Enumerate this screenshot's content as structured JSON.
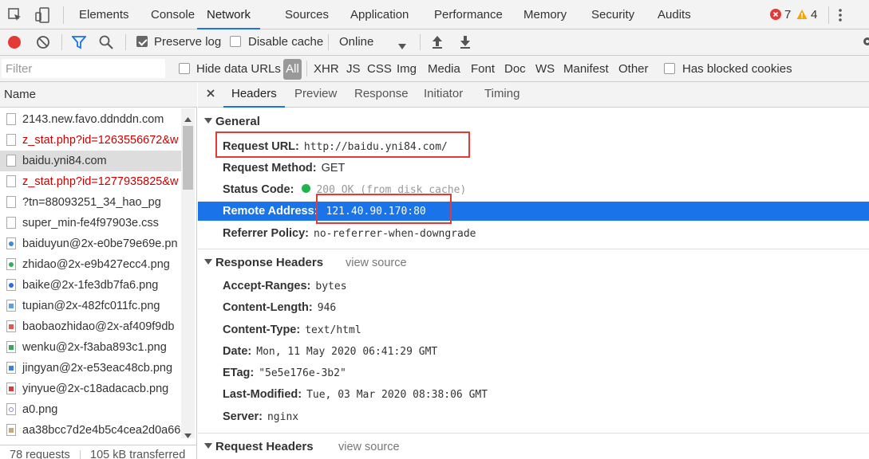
{
  "main_tabs": [
    "Elements",
    "Console",
    "Network",
    "Sources",
    "Application",
    "Performance",
    "Memory",
    "Security",
    "Audits"
  ],
  "active_main_tab": "Network",
  "counts": {
    "errors": "7",
    "warnings": "4"
  },
  "toolbar": {
    "preserve_log": "Preserve log",
    "disable_cache": "Disable cache",
    "throttle": "Online"
  },
  "filter": {
    "placeholder": "Filter",
    "hide_data_urls": "Hide data URLs",
    "all": "All",
    "types": [
      "XHR",
      "JS",
      "CSS",
      "Img",
      "Media",
      "Font",
      "Doc",
      "WS",
      "Manifest",
      "Other"
    ],
    "has_blocked_cookies": "Has blocked cookies"
  },
  "requests_panel": {
    "header": "Name",
    "rows": [
      {
        "name": "2143.new.favo.ddnddn.com"
      },
      {
        "name": "z_stat.php?id=1263556672&w"
      },
      {
        "name": "baidu.yni84.com"
      },
      {
        "name": "z_stat.php?id=1277935825&w"
      },
      {
        "name": "?tn=88093251_34_hao_pg"
      },
      {
        "name": "super_min-fe4f97903e.css"
      },
      {
        "name": "baiduyun@2x-e0be79e69e.pn"
      },
      {
        "name": "zhidao@2x-e9b427ecc4.png"
      },
      {
        "name": "baike@2x-1fe3db7fa6.png"
      },
      {
        "name": "tupian@2x-482fc011fc.png"
      },
      {
        "name": "baobaozhidao@2x-af409f9db"
      },
      {
        "name": "wenku@2x-f3aba893c1.png"
      },
      {
        "name": "jingyan@2x-e53eac48cb.png"
      },
      {
        "name": "yinyue@2x-c18adacacb.png"
      },
      {
        "name": "a0.png"
      },
      {
        "name": "aa38bcc7d2e4b5c4cea2d0a66"
      }
    ],
    "status": {
      "requests": "78 requests",
      "transferred": "105 kB transferred"
    }
  },
  "detail_tabs": [
    "Headers",
    "Preview",
    "Response",
    "Initiator",
    "Timing"
  ],
  "active_detail_tab": "Headers",
  "general": {
    "title": "General",
    "rows": [
      {
        "key": "Request URL:",
        "value": "http://baidu.yni84.com/"
      },
      {
        "key": "Request Method:",
        "value": "GET"
      },
      {
        "key": "Status Code:",
        "value": "200 OK (from disk cache)"
      },
      {
        "key": "Remote Address:",
        "value": "121.40.90.170:80"
      },
      {
        "key": "Referrer Policy:",
        "value": "no-referrer-when-downgrade"
      }
    ]
  },
  "response_headers": {
    "title": "Response Headers",
    "view_source": "view source",
    "rows": [
      {
        "key": "Accept-Ranges:",
        "value": "bytes"
      },
      {
        "key": "Content-Length:",
        "value": "946"
      },
      {
        "key": "Content-Type:",
        "value": "text/html"
      },
      {
        "key": "Date:",
        "value": "Mon, 11 May 2020 06:41:29 GMT"
      },
      {
        "key": "ETag:",
        "value": "\"5e5e176e-3b2\""
      },
      {
        "key": "Last-Modified:",
        "value": "Tue, 03 Mar 2020 08:38:06 GMT"
      },
      {
        "key": "Server:",
        "value": "nginx"
      }
    ]
  },
  "request_headers": {
    "title": "Request Headers",
    "view_source": "view source"
  },
  "colors": {
    "accent": "#1a73e8",
    "error_text": "#cc0000",
    "highlight_box": "#e53935",
    "record": "#e53935"
  }
}
